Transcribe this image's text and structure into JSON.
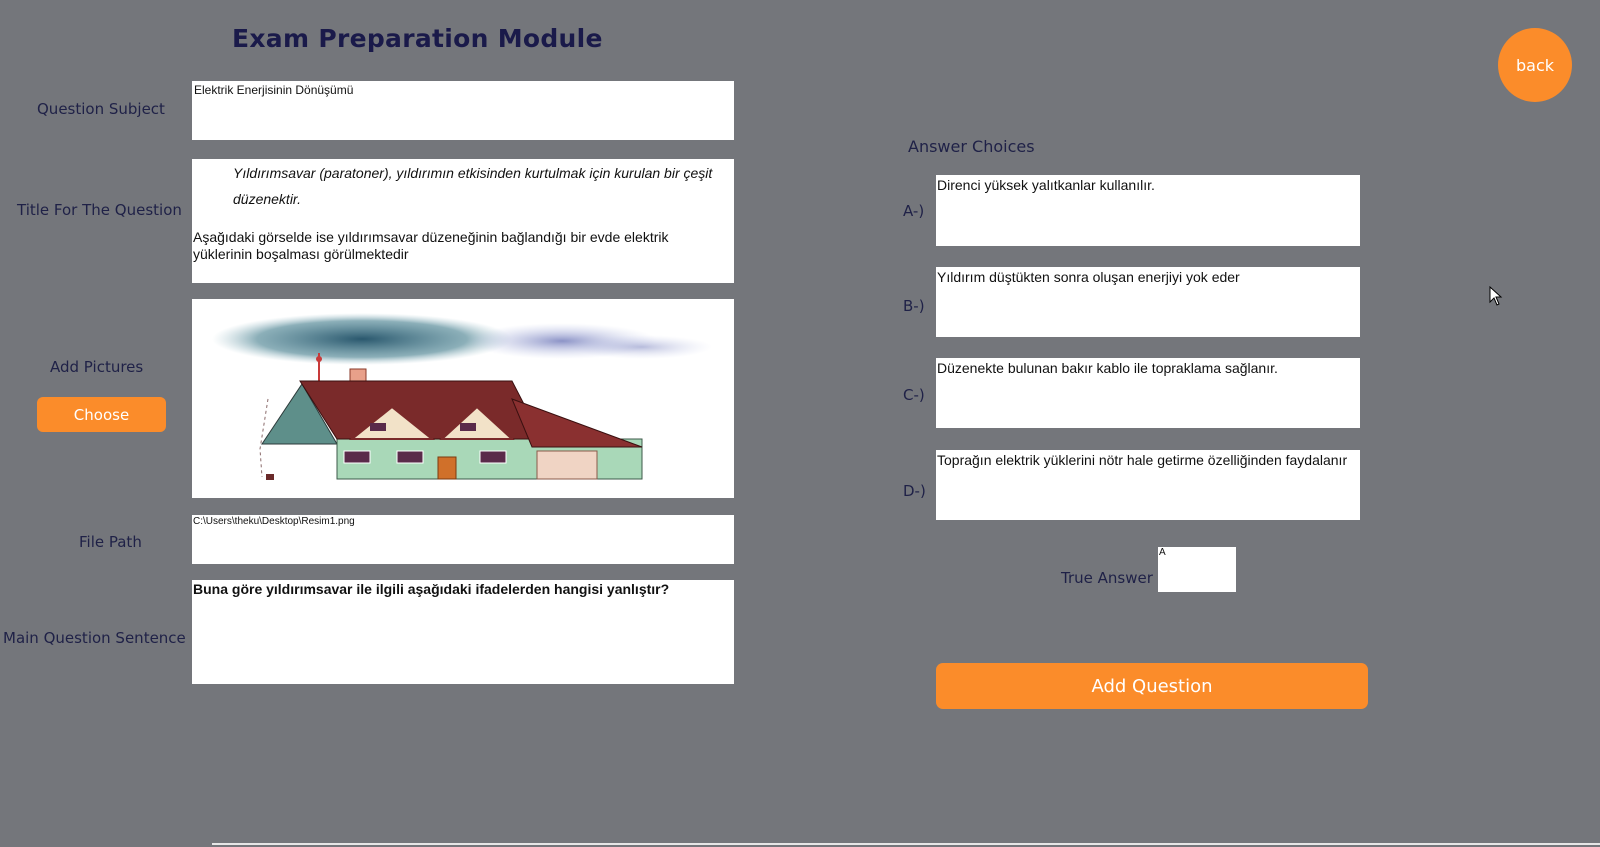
{
  "header": {
    "title": "Exam Preparation Module",
    "back_label": "back"
  },
  "form": {
    "subject": {
      "label": "Question Subject",
      "value": "Elektrik Enerjisinin Dönüşümü"
    },
    "question_title": {
      "label": "Title For The Question",
      "italic_line1": "Yıldırımsavar (paratoner), yıldırımın etkisinden kurtulmak için kurulan bir çeşit",
      "italic_line2": "düzenektir.",
      "body": "Aşağıdaki görselde ise yıldırımsavar düzeneğinin bağlandığı bir evde elektrik yüklerinin boşalması görülmektedir"
    },
    "pictures": {
      "label": "Add Pictures",
      "choose_label": "Choose"
    },
    "file_path": {
      "label": "File Path",
      "value": "C:\\Users\\theku\\Desktop\\Resim1.png"
    },
    "main_question": {
      "label": "Main Question Sentence",
      "value": "Buna göre yıldırımsavar ile ilgili aşağıdaki ifadelerden hangisi yanlıştır?"
    }
  },
  "answers": {
    "heading": "Answer Choices",
    "choices": [
      {
        "label": "A-)",
        "value": "Direnci yüksek yalıtkanlar kullanılır."
      },
      {
        "label": "B-)",
        "value": "Yıldırım düştükten sonra oluşan enerjiyi yok eder"
      },
      {
        "label": "C-)",
        "value": "Düzenekte bulunan bakır kablo ile topraklama sağlanır."
      },
      {
        "label": "D-)",
        "value": "Toprağın elektrik yüklerini nötr hale getirme özelliğinden faydalanır"
      }
    ],
    "true_answer": {
      "label": "True Answer",
      "value": "A"
    },
    "add_question_label": "Add Question"
  },
  "colors": {
    "background": "#74767b",
    "accent": "#fb8c2a",
    "label_text": "#1f2147"
  }
}
